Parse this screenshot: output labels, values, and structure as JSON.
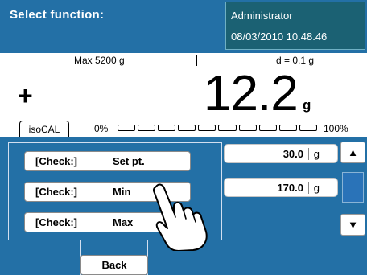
{
  "header": {
    "title": "Select function:",
    "user": "Administrator",
    "datetime": "08/03/2010 10.48.46"
  },
  "scale": {
    "max": "Max 5200 g",
    "d": "d = 0.1 g",
    "sign": "+",
    "weight": "12.2",
    "unit": "g",
    "isocal_label": "isoCAL",
    "bar_min": "0%",
    "bar_max": "100%",
    "bar_fill_fraction": 0,
    "bar_segments": 10
  },
  "fields": [
    {
      "value": "30.0",
      "unit": "g"
    },
    {
      "value": "170.0",
      "unit": "g"
    }
  ],
  "functions": [
    {
      "key": "[Check:]",
      "name": "Set pt."
    },
    {
      "key": "[Check:]",
      "name": "Min"
    },
    {
      "key": "[Check:]",
      "name": "Max"
    }
  ],
  "back_label": "Back",
  "scroll": {
    "up_icon": "▲",
    "down_icon": "▼"
  },
  "colors": {
    "header_bg": "#2370a6",
    "user_bg": "#1b6173",
    "panel_bg": "#2370a6"
  }
}
